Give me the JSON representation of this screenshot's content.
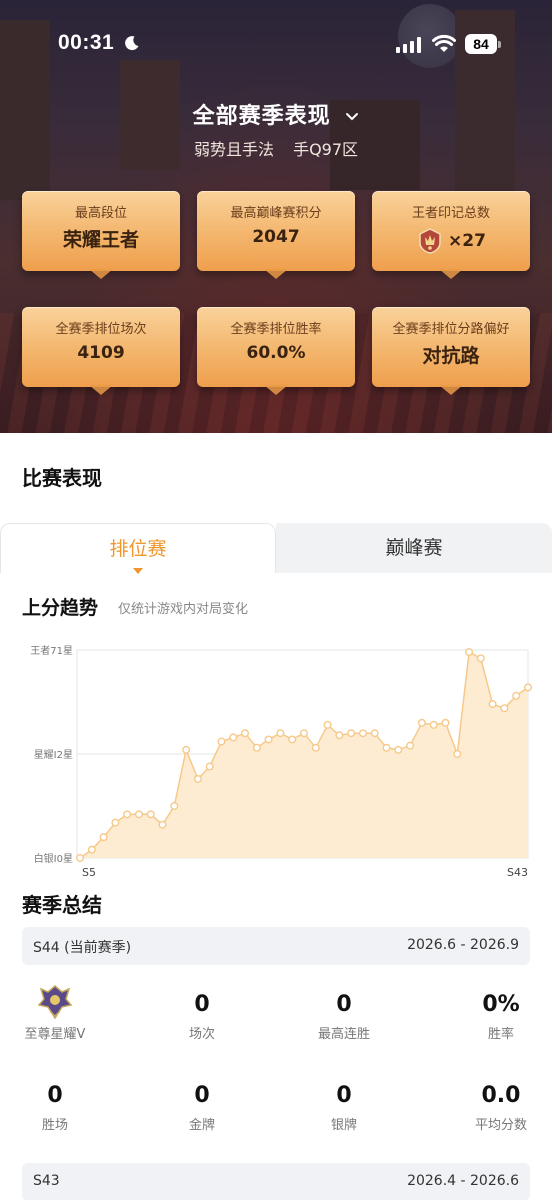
{
  "status_bar": {
    "time": "00:31",
    "battery": "84"
  },
  "hero": {
    "title": "全部赛季表现",
    "player_name": "弱势且手法",
    "server": "手Q97区",
    "cards": [
      {
        "label": "最高段位",
        "value": "荣耀王者"
      },
      {
        "label": "最高巅峰赛积分",
        "value": "2047"
      },
      {
        "label": "王者印记总数",
        "value": "×27"
      },
      {
        "label": "全赛季排位场次",
        "value": "4109"
      },
      {
        "label": "全赛季排位胜率",
        "value": "60.0%"
      },
      {
        "label": "全赛季排位分路偏好",
        "value": "对抗路"
      }
    ]
  },
  "match": {
    "heading": "比赛表现",
    "tabs": [
      {
        "label": "排位赛",
        "active": true
      },
      {
        "label": "巅峰赛",
        "active": false
      }
    ],
    "trend_title": "上分趋势",
    "trend_subtitle": "仅统计游戏内对局变化"
  },
  "chart_data": {
    "type": "area",
    "title": "上分趋势",
    "y_tick_labels": [
      "王者71星",
      "星耀I2星",
      "白银I0星"
    ],
    "x_tick_labels": [
      "S5",
      "S43"
    ],
    "x": [
      "S5",
      "S6",
      "S7",
      "S8",
      "S9",
      "S10",
      "S11",
      "S12",
      "S13",
      "S14",
      "S15",
      "S16",
      "S17",
      "S18",
      "S19",
      "S20",
      "S21",
      "S22",
      "S23",
      "S24",
      "S25",
      "S26",
      "S27",
      "S28",
      "S29",
      "S30",
      "S31",
      "S32",
      "S33",
      "S34",
      "S35",
      "S36",
      "S37",
      "S38",
      "S39",
      "S40",
      "S41",
      "S42",
      "S43"
    ],
    "y_normalized": [
      0.0,
      0.04,
      0.1,
      0.17,
      0.21,
      0.21,
      0.21,
      0.16,
      0.25,
      0.52,
      0.38,
      0.44,
      0.56,
      0.58,
      0.6,
      0.53,
      0.57,
      0.6,
      0.57,
      0.6,
      0.53,
      0.64,
      0.59,
      0.6,
      0.6,
      0.6,
      0.53,
      0.52,
      0.54,
      0.65,
      0.64,
      0.65,
      0.5,
      0.99,
      0.96,
      0.74,
      0.72,
      0.78,
      0.82
    ],
    "y_scale_note": "0 = 白银I0星 baseline, 0.5 = 星耀I2星, 1 = 王者71星",
    "grid": true,
    "fill_color": "#fdecd2",
    "line_color": "#f6c98a",
    "point_color": "#ffffff"
  },
  "summary": {
    "heading": "赛季总结",
    "seasons": [
      {
        "name": "S44 (当前赛季)",
        "range": "2026.6 - 2026.9",
        "rank_label": "至尊星耀V",
        "metrics_row1": [
          {
            "value": "0",
            "label": "场次"
          },
          {
            "value": "0",
            "label": "最高连胜"
          },
          {
            "value": "0%",
            "label": "胜率"
          }
        ],
        "metrics_row2": [
          {
            "value": "0",
            "label": "胜场"
          },
          {
            "value": "0",
            "label": "金牌"
          },
          {
            "value": "0",
            "label": "银牌"
          },
          {
            "value": "0.0",
            "label": "平均分数"
          }
        ]
      },
      {
        "name": "S43",
        "range": "2026.4 - 2026.6"
      }
    ]
  }
}
